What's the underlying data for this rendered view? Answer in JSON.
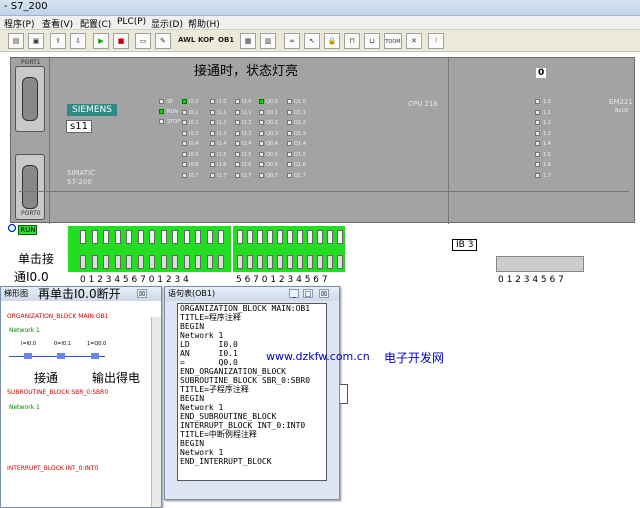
{
  "window": {
    "title": "- S7_200"
  },
  "menu": [
    "程序(P)",
    "查看(V)",
    "配置(C)",
    "PLC(P)",
    "显示(D)",
    "帮助(H)"
  ],
  "toolbar": {
    "awl": "AWL",
    "kop": "KOP",
    "ob1": "OB1",
    "toom": "TOOM"
  },
  "annotations": {
    "led_note": "接通时，状态灯亮",
    "click_note_1": "单击接",
    "click_note_2": "通I0.0",
    "click_note_3": "再单击I0.0断开",
    "contact_note": "接通",
    "output_note": "输出得电",
    "watermark_url": "www.dzkfw.com.cn",
    "watermark_cn": "电子开发网"
  },
  "plc": {
    "port1": "PORT1",
    "port0": "PORT0",
    "brand": "SIEMENS",
    "label": "s11",
    "simatic_1": "SIMATIC",
    "simatic_2": "S7-200",
    "cpu": "CPU 216",
    "em": "EM221",
    "em_sub": "8x1D",
    "display_value": "0",
    "status": [
      "SF",
      "RUN",
      "STOP"
    ],
    "inputs_a": [
      "I0.0",
      "I0.1",
      "I0.2",
      "I0.3",
      "I0.4",
      "I0.5",
      "I0.6",
      "I0.7"
    ],
    "inputs_b": [
      "I1.0",
      "I1.1",
      "I1.2",
      "I1.3",
      "I1.4",
      "I1.5",
      "I1.6",
      "I1.7"
    ],
    "inputs_c": [
      "I2.0",
      "I2.1",
      "I2.2",
      "I2.3",
      "I2.4",
      "I2.5",
      "I2.6",
      "I2.7"
    ],
    "outputs_a": [
      "Q0.0",
      "Q0.1",
      "Q0.2",
      "Q0.3",
      "Q0.4",
      "Q0.5",
      "Q0.6",
      "Q0.7"
    ],
    "outputs_b": [
      "Q1.0",
      "Q1.1",
      "Q1.2",
      "Q1.3",
      "Q1.4",
      "Q1.5",
      "Q1.6",
      "Q1.7"
    ],
    "em_leds": [
      "1.0",
      "1.1",
      "1.2",
      "1.3",
      "1.4",
      "1.5",
      "1.6",
      "1.7"
    ],
    "run_indicator": "RUN",
    "switch_numbers_a": "0 1 2 3 4 5 6 7 0 1 2 3 4",
    "switch_numbers_b": "5 6 7 0 1 2 3 4 5 6 7",
    "ib_label": "IB 3",
    "ib_numbers": "0 1 2 3 4 5 6 7"
  },
  "ladder": {
    "title": "梯形图",
    "close": "☒",
    "ob_main": "ORGANIZATION_BLOCK MAIN:OB1",
    "network1": "Network 1",
    "c1": "I=I0.0",
    "c2": "0=I0.1",
    "coil": "1=Q0.0",
    "sbr": "SUBROUTINE_BLOCK SBR_0:SBR0",
    "network1b": "Network 1",
    "int": "INTERRUPT_BLOCK INT_0:INT0"
  },
  "stl": {
    "title": "语句表(OB1)",
    "min": "_",
    "max": "□",
    "close": "☒",
    "lines": [
      "ORGANIZATION_BLOCK MAIN:OB1",
      "TITLE=程序注释",
      "BEGIN",
      "Network 1",
      "LD      I0.0",
      "AN      I0.1",
      "=       Q0.0",
      "END_ORGANIZATION_BLOCK",
      "SUBROUTINE_BLOCK SBR_0:SBR0",
      "TITLE=子程序注释",
      "BEGIN",
      "Network 1",
      "END_SUBROUTINE_BLOCK",
      "INTERRUPT_BLOCK INT_0:INT0",
      "TITLE=中断例程注释",
      "BEGIN",
      "Network 1",
      "END_INTERRUPT_BLOCK"
    ]
  }
}
